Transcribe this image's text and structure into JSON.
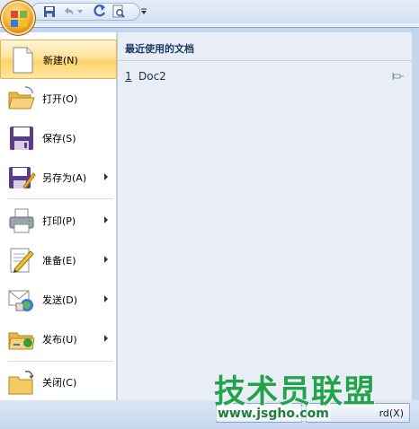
{
  "toolbar": {
    "save_icon": "save-icon",
    "undo_icon": "undo-icon",
    "redo_icon": "redo-icon",
    "print_preview_icon": "print-preview-icon",
    "customize_icon": "chevron-down-icon"
  },
  "menu": {
    "items": [
      {
        "label": "新建(N)",
        "icon": "new-document-icon",
        "submenu": false
      },
      {
        "label": "打开(O)",
        "icon": "open-folder-icon",
        "submenu": false
      },
      {
        "label": "保存(S)",
        "icon": "save-icon",
        "submenu": false
      },
      {
        "label": "另存为(A)",
        "icon": "save-as-icon",
        "submenu": true
      },
      {
        "label": "打印(P)",
        "icon": "printer-icon",
        "submenu": true
      },
      {
        "label": "准备(E)",
        "icon": "prepare-icon",
        "submenu": true
      },
      {
        "label": "发送(D)",
        "icon": "send-icon",
        "submenu": true
      },
      {
        "label": "发布(U)",
        "icon": "publish-icon",
        "submenu": true
      },
      {
        "label": "关闭(C)",
        "icon": "close-folder-icon",
        "submenu": false
      }
    ]
  },
  "recent": {
    "title": "最近使用的文档",
    "items": [
      {
        "num": "1",
        "name": "Doc2"
      }
    ]
  },
  "bottom": {
    "exit_label": "rd(X)"
  },
  "watermark": {
    "title": "技术员联盟",
    "url": "www.jsgho.com"
  }
}
